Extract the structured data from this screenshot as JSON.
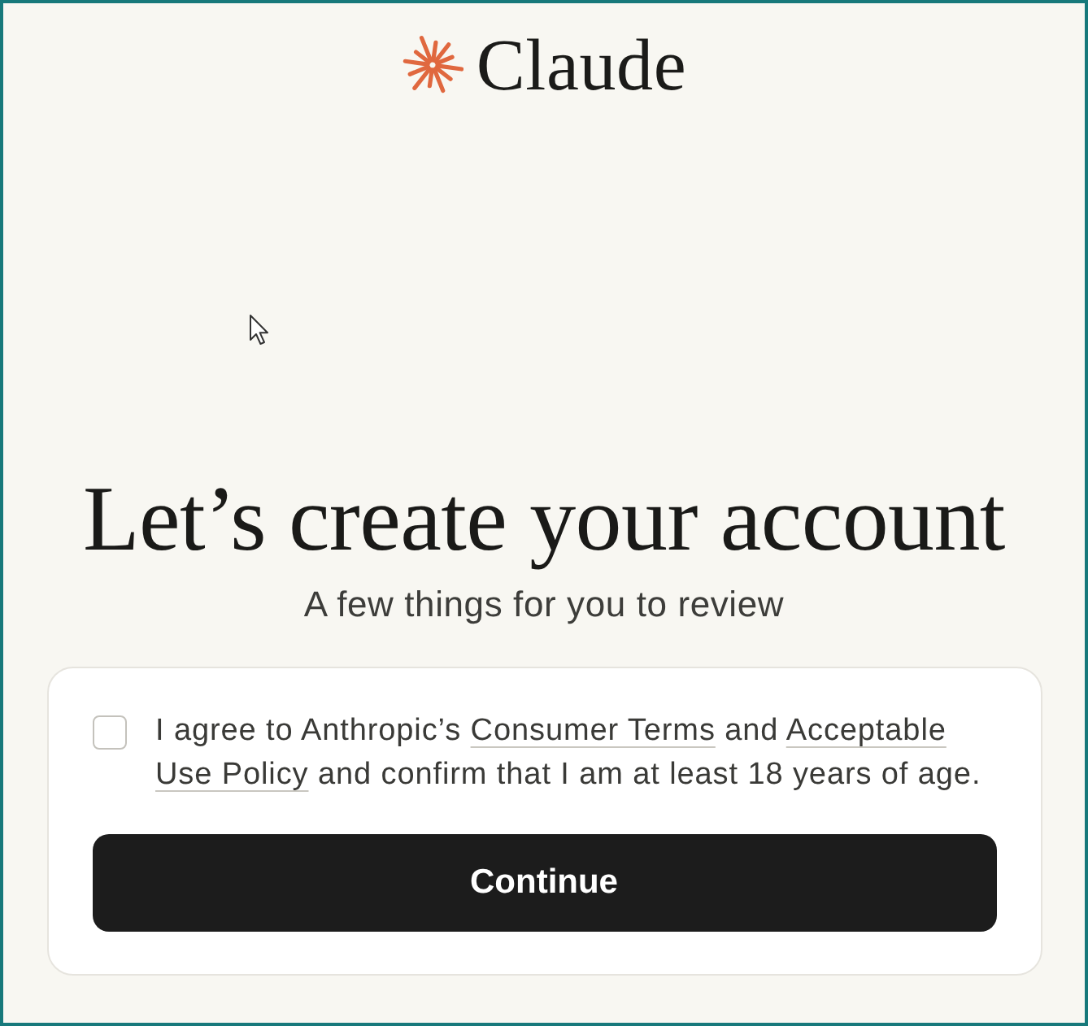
{
  "logo": {
    "wordmark": "Claude"
  },
  "heading": "Let’s create your account",
  "subtitle": "A few things for you to review",
  "agreement": {
    "checked": false,
    "parts": [
      {
        "kind": "text",
        "text": "I agree to Anthropic’s "
      },
      {
        "kind": "link",
        "lines": [
          "Consumer Terms"
        ]
      },
      {
        "kind": "text",
        "text": " and "
      },
      {
        "kind": "link",
        "lines": [
          "Acceptable",
          "Use Policy"
        ]
      },
      {
        "kind": "text",
        "text": " and confirm that I am at least 18 years of age."
      }
    ]
  },
  "button": {
    "label": "Continue"
  }
}
